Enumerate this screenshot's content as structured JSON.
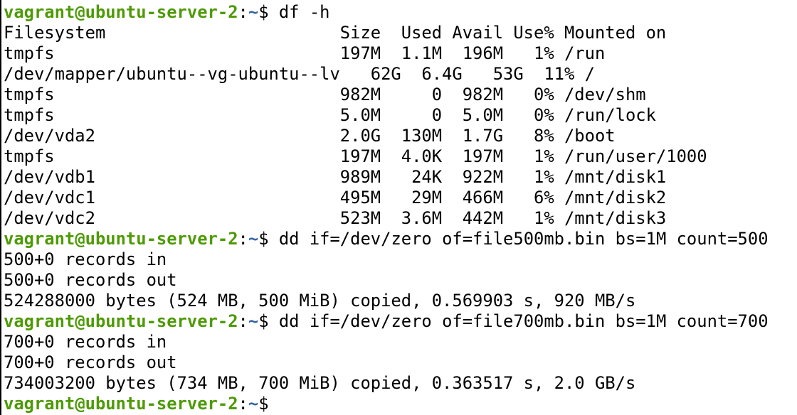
{
  "terminal": {
    "colors": {
      "background": "#ffffff",
      "text": "#000000",
      "prompt_user_host": "#4e9a06",
      "prompt_path": "#3465a4"
    },
    "prompt": {
      "user_host": "vagrant@ubuntu-server-2",
      "separator": ":",
      "path": "~",
      "dollar": "$ "
    },
    "commands": {
      "df": "df -h",
      "dd_500": "dd if=/dev/zero of=file500mb.bin bs=1M count=500",
      "dd_700": "dd if=/dev/zero of=file700mb.bin bs=1M count=700"
    },
    "df_output": {
      "header": "Filesystem                       Size  Used Avail Use% Mounted on",
      "rows": [
        "tmpfs                            197M  1.1M  196M   1% /run",
        "/dev/mapper/ubuntu--vg-ubuntu--lv   62G  6.4G   53G  11% /",
        "tmpfs                            982M     0  982M   0% /dev/shm",
        "tmpfs                            5.0M     0  5.0M   0% /run/lock",
        "/dev/vda2                        2.0G  130M  1.7G   8% /boot",
        "tmpfs                            197M  4.0K  197M   1% /run/user/1000",
        "/dev/vdb1                        989M   24K  922M   1% /mnt/disk1",
        "/dev/vdc1                        495M   29M  466M   6% /mnt/disk2",
        "/dev/vdc2                        523M  3.6M  442M   1% /mnt/disk3"
      ]
    },
    "dd_500_output": [
      "500+0 records in",
      "500+0 records out",
      "524288000 bytes (524 MB, 500 MiB) copied, 0.569903 s, 920 MB/s"
    ],
    "dd_700_output": [
      "700+0 records in",
      "700+0 records out",
      "734003200 bytes (734 MB, 700 MiB) copied, 0.363517 s, 2.0 GB/s"
    ]
  }
}
